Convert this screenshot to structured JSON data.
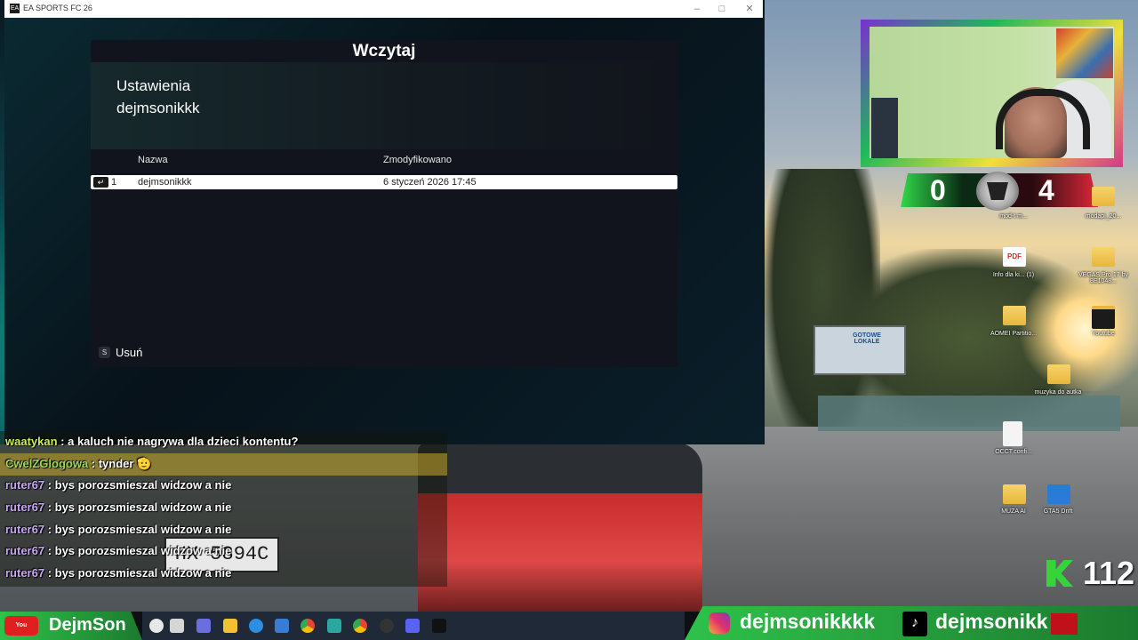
{
  "window": {
    "title": "EA SPORTS FC 26",
    "icon_label": "EA",
    "minimize": "–",
    "maximize": "□",
    "close": "✕"
  },
  "dialog": {
    "title": "Wczytaj",
    "section_title_line1": "Ustawienia",
    "section_title_line2": "dejmsonikkk",
    "columns": [
      "Nazwa",
      "Zmodyfikowano"
    ],
    "rows": [
      {
        "num": "1",
        "name": "dejmsonikkk",
        "modified": "6 styczeń 2026 17:45"
      }
    ],
    "delete_key": "S",
    "delete_label": "Usuń"
  },
  "scoreboard": {
    "home": "0",
    "away": "4"
  },
  "desktop_icons": [
    {
      "name": "mod-t m...",
      "kind": "folder"
    },
    {
      "name": "modapi_20...",
      "kind": "folder"
    },
    {
      "name": "Info dla ki... (1)",
      "kind": "pdf"
    },
    {
      "name": "VEGAS Pro 17 by 8E1048...",
      "kind": "folder"
    },
    {
      "name": "AOMEI Partitio...",
      "kind": "folder"
    },
    {
      "name": "Youtube",
      "kind": "folder"
    },
    {
      "name": "muzyka do autka",
      "kind": "folder"
    },
    {
      "name": "OCCT.confi...",
      "kind": "file"
    },
    {
      "name": "MUZA AI",
      "kind": "folder"
    },
    {
      "name": "GTA5 Drift",
      "kind": "app"
    }
  ],
  "chat": [
    {
      "user": "waatykan",
      "message": " : a kaluch nie nagrywa dla dzieci kontentu?"
    },
    {
      "user": "CwelZGlogowa",
      "message": " : tynder"
    },
    {
      "user": "ruter67",
      "message": " : bys porozsmieszal widzow a nie"
    },
    {
      "user": "ruter67",
      "message": " : bys porozsmieszal widzow a nie"
    },
    {
      "user": "ruter67",
      "message": " : bys porozsmieszal widzow a nie"
    },
    {
      "user": "ruter67",
      "message": " : bys porozsmieszal widzow a nie"
    },
    {
      "user": "ruter67",
      "message": " : bys porozsmieszal widzow a nie"
    }
  ],
  "bus_plate": "HX 5894C",
  "billboard": "GOTOWE LOKALE",
  "viewer_count": "112",
  "socials": {
    "youtube": "DejmSon",
    "instagram": "dejmsonikkkk",
    "tiktok": "dejmsonikk"
  },
  "colors": {
    "accent_green": "#2ec24a",
    "score_red": "#e0283a",
    "dialog_bg": "#11141c"
  }
}
